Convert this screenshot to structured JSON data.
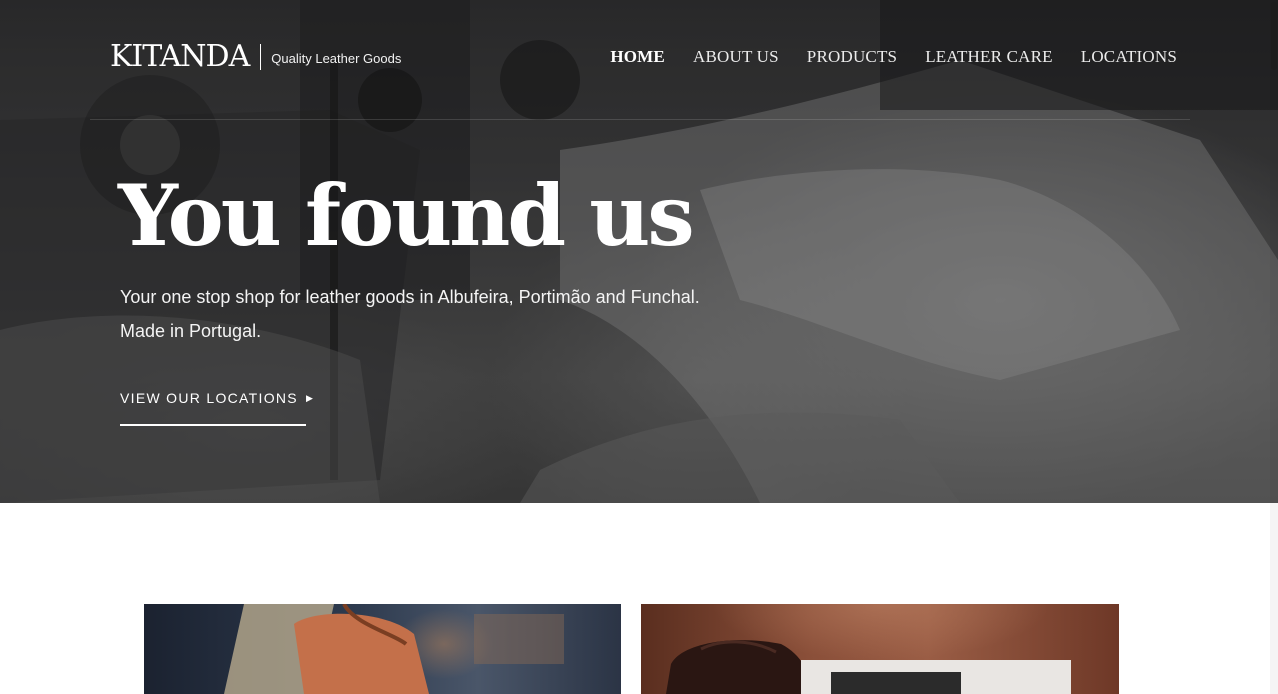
{
  "brand": {
    "name": "KITANDA",
    "tagline": "Quality Leather Goods"
  },
  "nav": {
    "items": [
      {
        "label": "HOME",
        "active": true
      },
      {
        "label": "ABOUT US",
        "active": false
      },
      {
        "label": "PRODUCTS",
        "active": false
      },
      {
        "label": "LEATHER CARE",
        "active": false
      },
      {
        "label": "LOCATIONS",
        "active": false
      }
    ]
  },
  "hero": {
    "title": "You found us",
    "subtitle_line1": "Your one stop shop for leather goods in Albufeira, Portimão and Funchal.",
    "subtitle_line2": "Made in Portugal.",
    "cta_label": "VIEW OUR LOCATIONS",
    "cta_icon": "triangle-right-icon"
  },
  "cards": [
    {
      "image": "handbag-photo"
    },
    {
      "image": "leather-bag-photo"
    }
  ],
  "colors": {
    "text_on_dark": "#ffffff",
    "page_background": "#ffffff",
    "hero_tint": "#3a3a3b"
  }
}
